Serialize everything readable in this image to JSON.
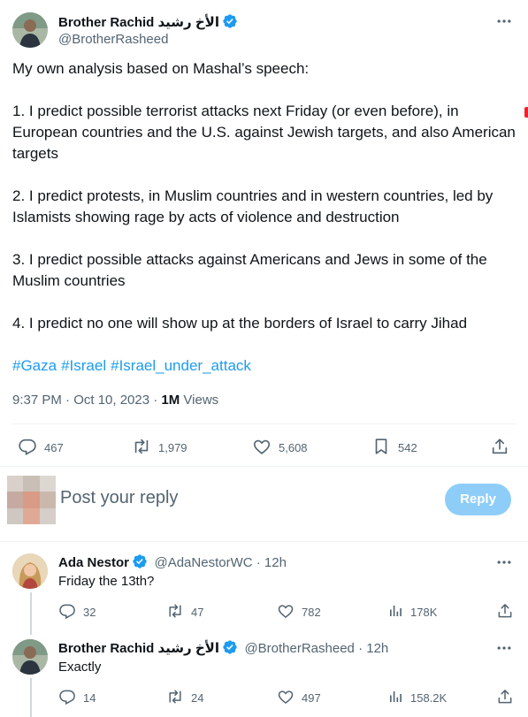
{
  "main_tweet": {
    "author_name": "Brother Rachid الأخ رشيد",
    "handle": "@BrotherRasheed",
    "paragraphs": [
      "My own analysis based on Mashal’s speech:",
      "1. I predict possible terrorist attacks next Friday (or even before), in European countries and the U.S. against Jewish targets, and also American targets",
      "2. I predict protests, in Muslim countries and in western countries, led by Islamists showing rage by acts of violence and destruction",
      "3. I predict possible attacks against Americans and Jews in some of the Muslim countries",
      "4. I predict no one will show up at the borders of Israel to carry Jihad"
    ],
    "hashtags": [
      "#Gaza",
      "#Israel",
      "#Israel_under_attack"
    ],
    "time": "9:37 PM · Oct 10, 2023 · ",
    "views_count": "1M",
    "views_label": " Views",
    "stats": {
      "replies": "467",
      "reposts": "1,979",
      "likes": "5,608",
      "bookmarks": "542"
    }
  },
  "compose": {
    "placeholder": "Post your reply",
    "button_label": "Reply"
  },
  "replies": [
    {
      "author_name": "Ada Nestor",
      "handle": "@AdaNestorWC",
      "time": " · 12h",
      "text": "Friday the 13th?",
      "stats": {
        "replies": "32",
        "reposts": "47",
        "likes": "782",
        "views": "178K"
      }
    },
    {
      "author_name": "Brother Rachid الأخ رشيد",
      "handle": "@BrotherRasheed",
      "time": " · 12h",
      "text": "Exactly",
      "stats": {
        "replies": "14",
        "reposts": "24",
        "likes": "497",
        "views": "158.2K"
      }
    }
  ],
  "colors": {
    "accent": "#1d9bf0",
    "reply_button": "#8ecdf8",
    "secondary_text": "#536471",
    "divider": "#eff3f4"
  },
  "icons": {
    "verified": "verified-badge-icon",
    "more": "more-options-icon",
    "reply": "reply-icon",
    "repost": "repost-icon",
    "like": "like-icon",
    "bookmark": "bookmark-icon",
    "share": "share-icon",
    "views": "views-icon"
  }
}
